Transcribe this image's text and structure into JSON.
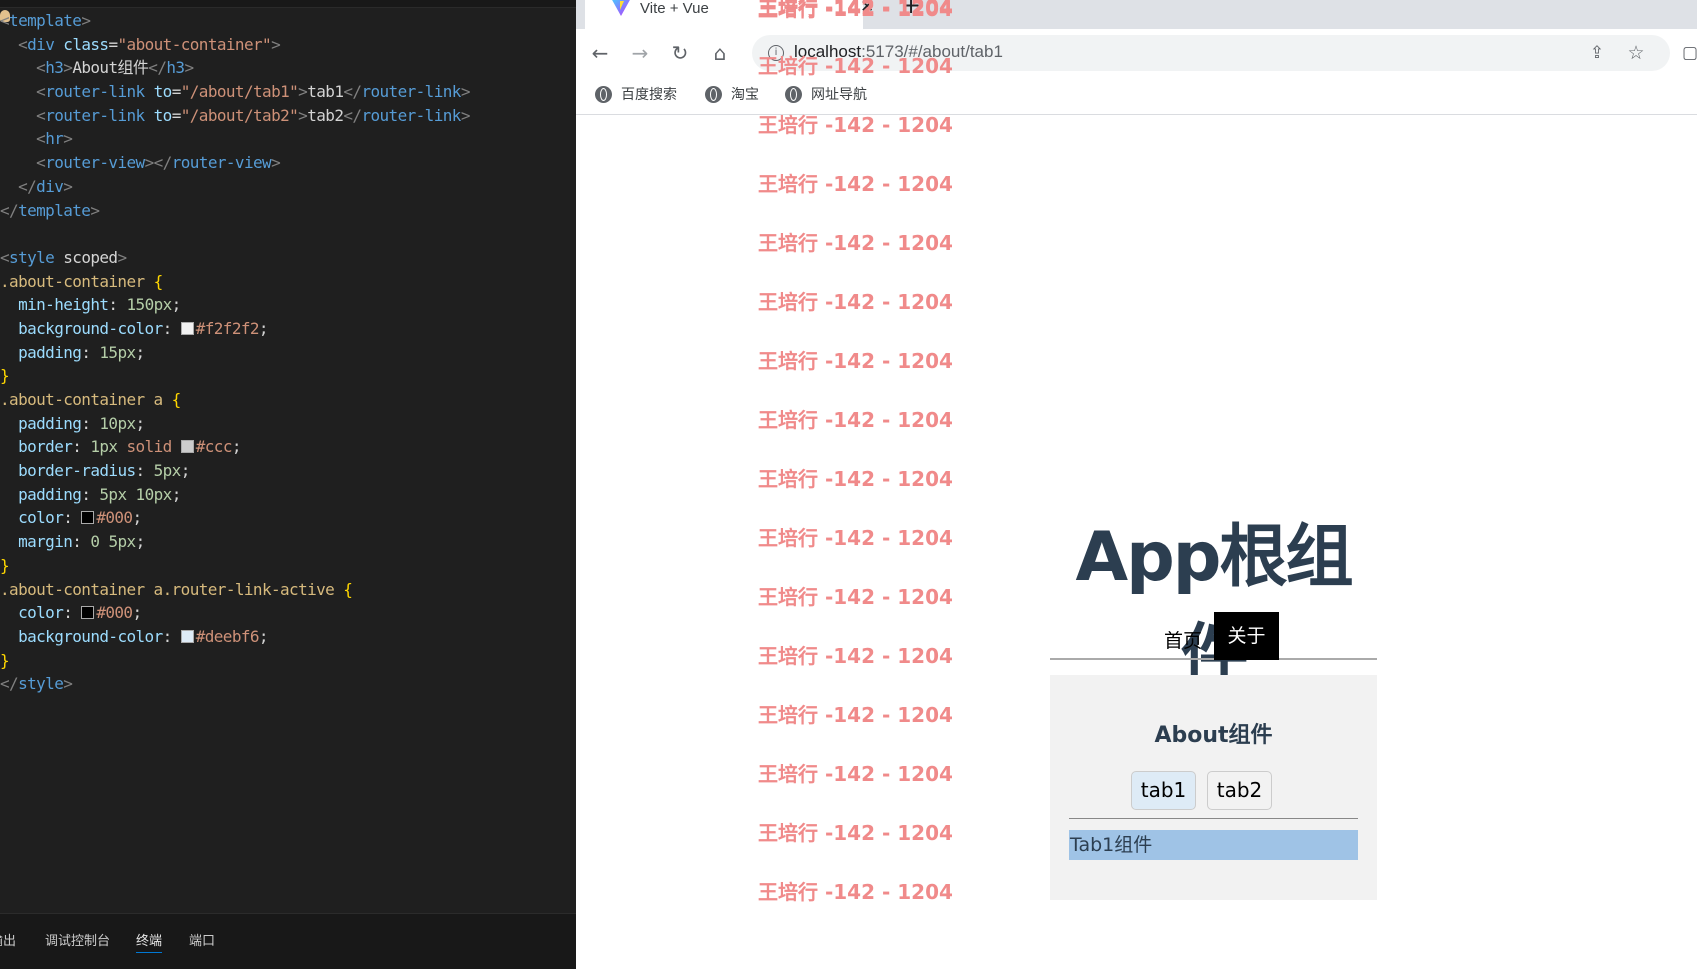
{
  "editor": {
    "template_lines": [
      "<template>",
      "  <div class=\"about-container\">",
      "    <h3>About组件</h3>",
      "    <router-link to=\"/about/tab1\">tab1</router-link>",
      "    <router-link to=\"/about/tab2\">tab2</router-link>",
      "    <hr>",
      "    <router-view></router-view>",
      "  </div>",
      "</template>"
    ],
    "style_open": "<style scoped>",
    "style_close": "</style>",
    "rules": [
      {
        "selector": ".about-container",
        "decls": [
          [
            "min-height",
            "150px"
          ],
          [
            "background-color",
            "#f2f2f2"
          ],
          [
            "padding",
            "15px"
          ]
        ]
      },
      {
        "selector": ".about-container a",
        "decls": [
          [
            "padding",
            "10px"
          ],
          [
            "border",
            "1px solid #ccc"
          ],
          [
            "border-radius",
            "5px"
          ],
          [
            "padding",
            "5px 10px"
          ],
          [
            "color",
            "#000"
          ],
          [
            "margin",
            "0 5px"
          ]
        ]
      },
      {
        "selector": ".about-container a.router-link-active",
        "decls": [
          [
            "color",
            "#000"
          ],
          [
            "background-color",
            "#deebf6"
          ]
        ]
      }
    ],
    "panel_tabs": [
      "输出",
      "调试控制台",
      "终端",
      "端口"
    ],
    "active_panel_tab": "终端"
  },
  "browser": {
    "tab_title": "Vite + Vue",
    "url_host": "localhost",
    "url_rest": ":5173/#/about/tab1",
    "bookmarks": [
      "百度搜索",
      "淘宝",
      "网址导航"
    ],
    "watermark": "王培行 -142 - 1204",
    "watermark_count": 16
  },
  "app": {
    "title": "App根组件",
    "nav_home": "首页",
    "nav_about": "关于",
    "about_title": "About组件",
    "tab1": "tab1",
    "tab2": "tab2",
    "tab1_content": "Tab1组件"
  },
  "colors": {
    "about_bg": "#f2f2f2",
    "active_link_bg": "#deebf6",
    "watermark": "#f08a8a",
    "title": "#2c3e50"
  }
}
